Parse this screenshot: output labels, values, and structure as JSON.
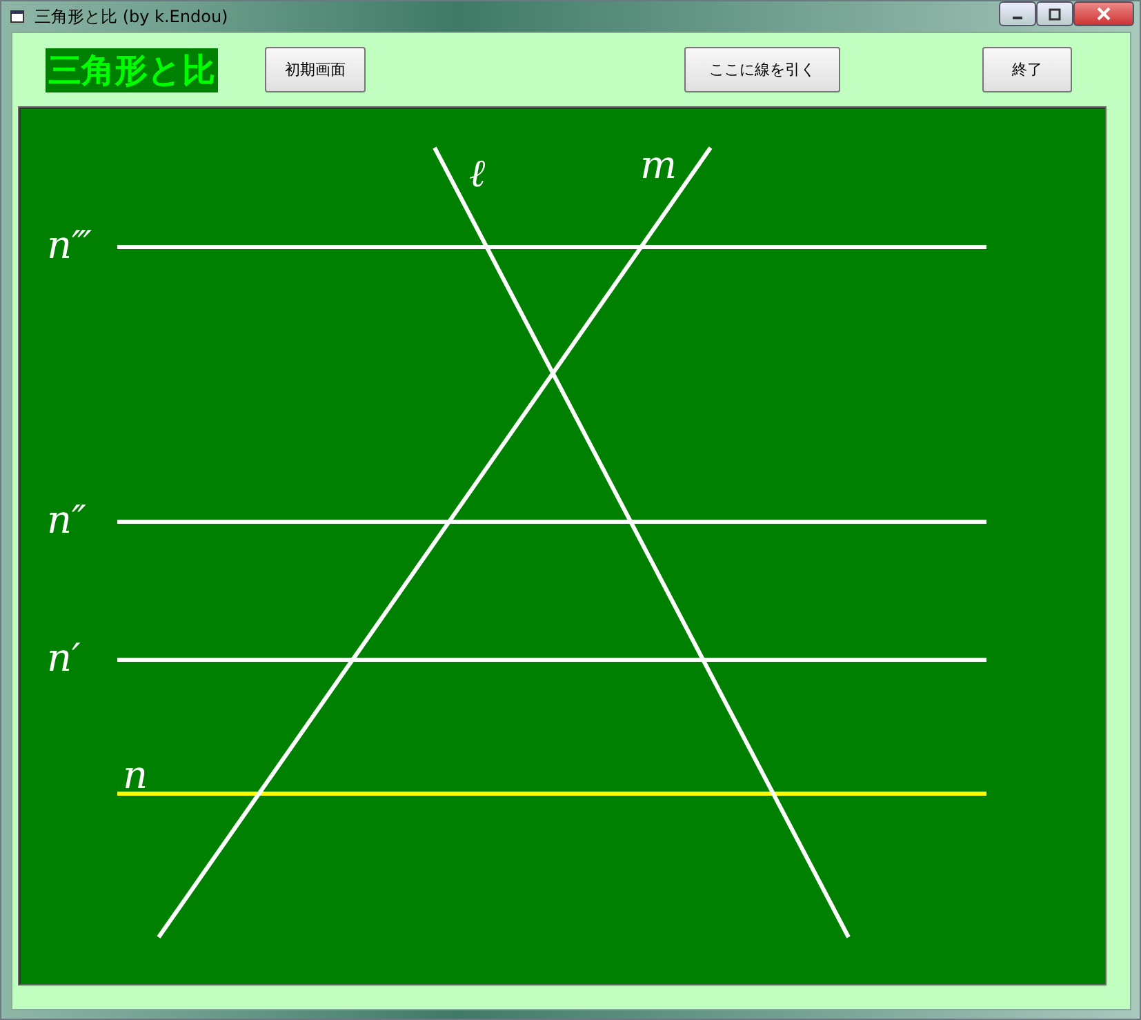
{
  "window": {
    "title": "三角形と比 (by k.Endou)"
  },
  "heading": "三角形と比",
  "buttons": [
    "初期画面",
    "ここに線を引く",
    "終了"
  ],
  "diagram": {
    "parallels": [
      {
        "label": "n‴",
        "color": "#ffffff"
      },
      {
        "label": "n″",
        "color": "#ffffff"
      },
      {
        "label": "n′",
        "color": "#ffffff"
      },
      {
        "label": "n",
        "color": "#ffff00"
      }
    ],
    "transversals": [
      {
        "label": "ℓ"
      },
      {
        "label": "m"
      }
    ]
  }
}
